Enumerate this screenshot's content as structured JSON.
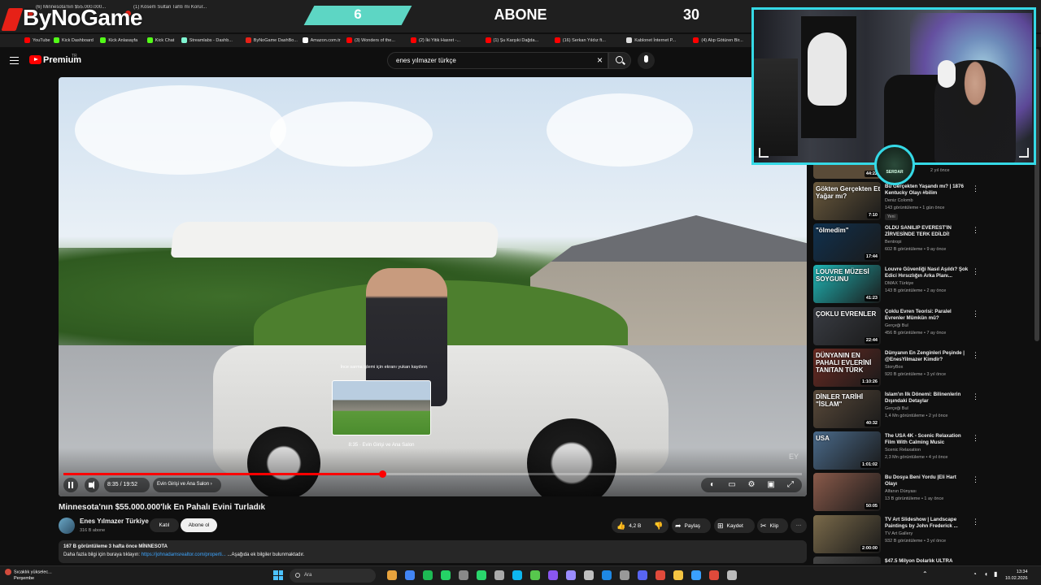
{
  "overlay": {
    "logo_text": "ByNoGame",
    "subscriber_count": "6",
    "label": "ABONE",
    "goal": "30"
  },
  "browser": {
    "tabs": [
      {
        "label": "(6) Minnesota'nın $55.000.000..."
      },
      {
        "label": "(1) Kösem Sultan Tahtı mı Korur..."
      },
      {
        "label": "ByNoGame"
      }
    ],
    "bookmarks": [
      {
        "label": "YouTube",
        "color": "#ff0000"
      },
      {
        "label": "Kick Dashboard",
        "color": "#53fc18"
      },
      {
        "label": "Kick Anlasayfa",
        "color": "#53fc18"
      },
      {
        "label": "Kick Chat",
        "color": "#53fc18"
      },
      {
        "label": "Streamlabs - Dashb...",
        "color": "#80f5d2"
      },
      {
        "label": "ByNoGame DashBo...",
        "color": "#e62117"
      },
      {
        "label": "Amazon.com.tr",
        "color": "#ffffff"
      },
      {
        "label": "(3) Wonders of the...",
        "color": "#ff0000"
      },
      {
        "label": "(2) İki Yitik Hasret -...",
        "color": "#ff0000"
      },
      {
        "label": "(1) Şu Karşıki Dağda...",
        "color": "#ff0000"
      },
      {
        "label": "(16) Serkan Yıldız ft...",
        "color": "#ff0000"
      },
      {
        "label": "Kablonet İnternet P...",
        "color": "#dddddd"
      },
      {
        "label": "(4) Alıp Götüren Bir...",
        "color": "#ff0000"
      }
    ]
  },
  "youtube": {
    "brand": "Premium",
    "country": "TR",
    "search_value": "enes yılmazer türkçe"
  },
  "player": {
    "seek_hint": "İnce sarma işlemi için ekranı yukarı kaydırın",
    "preview_label": "8:35 · Evin Girişi ve Ana Salon",
    "time": "8:35 / 19:52",
    "chapter": "Evin Girişi ve Ana Salon",
    "progress": 0.432,
    "watermark": "EY"
  },
  "video": {
    "title": "Minnesota'nın $55.000.000'lık En Pahalı Evini Turladık",
    "channel": "Enes Yılmazer Türkiye",
    "subscribers": "316 B abone",
    "join_label": "Katıl",
    "subscribed_label": "Abone ol",
    "likes": "4,2 B",
    "share_label": "Paylaş",
    "save_label": "Kaydet",
    "clip_label": "Klip",
    "views_line": "167 B görüntüleme  3 hafta önce  MİNNESOTA",
    "desc_prefix": "Daha fazla bilgi için buraya tıklayın: ",
    "desc_link": "https://johnadamsrealtor.com/properti...",
    "desc_suffix": "  ...Aşağıda ek bilgiler bulunmaktadır."
  },
  "sidebar": {
    "top_meta": "2 yıl önce",
    "top_duration": "44:22",
    "items": [
      {
        "title": "Bu Gerçekten Yaşandı mı? | 1876 Kentucky Olayı #bilim",
        "channel": "Deniz Colomb",
        "meta": "143 görüntüleme • 1 gün önce",
        "badge": "Yeni",
        "duration": "7:10",
        "thumb_text": "Gökten Gerçekten Et Yağar mı?",
        "color": "#6b5a3d"
      },
      {
        "title": "ÖLDÜ SANILIP EVEREST'İN ZİRVESİNDE TERK EDİLDİ!",
        "channel": "Bentropi",
        "meta": "602 B görüntüleme • 9 ay önce",
        "badge": "",
        "duration": "17:44",
        "thumb_text": "\"ölmedim\"",
        "color": "#10314f"
      },
      {
        "title": "Louvre Güvenliği Nasıl Aşıldı? Şok Edici Hırsızlığın Arka Planı...",
        "channel": "DMAX Türkiye",
        "meta": "143 B görüntüleme • 2 ay önce",
        "badge": "",
        "duration": "41:23",
        "thumb_text": "LOUVRE MÜZESİ SOYGUNU",
        "color": "#1fb5b5"
      },
      {
        "title": "Çoklu Evren Teorisi: Paralel Evrenler Mümkün mü?",
        "channel": "Gerçeği Bul",
        "meta": "456 B görüntüleme • 7 ay önce",
        "badge": "",
        "duration": "22:44",
        "thumb_text": "ÇOKLU EVRENLER",
        "color": "#3a3d44"
      },
      {
        "title": "Dünyanın En Zenginleri Peşinde | @EnesYilmazer  Kimdir?",
        "channel": "StoryBox",
        "meta": "920 B görüntüleme • 3 yıl önce",
        "badge": "",
        "duration": "1:10:26",
        "thumb_text": "DÜNYANIN EN PAHALI EVLERİNİ TANITAN TÜRK",
        "color": "#6b2a22"
      },
      {
        "title": "İslam'ın İlk Dönemi: Bilinenlerin Dışındaki Detaylar",
        "channel": "Gerçeği Bul",
        "meta": "1,4 Mn görüntüleme • 2 yıl önce",
        "badge": "",
        "duration": "40:32",
        "thumb_text": "DİNLER TARİHİ \"İSLAM\"",
        "color": "#5a4a3a"
      },
      {
        "title": "The USA 4K - Scenic Relaxation Film With Calming Music",
        "channel": "Scenic Relaxation",
        "meta": "2,3 Mn görüntüleme • 4 yıl önce",
        "badge": "",
        "duration": "1:01:02",
        "thumb_text": "USA",
        "color": "#4a6a8a"
      },
      {
        "title": "Bu Dosya Beni Yordu |Eli Hart Olayı",
        "channel": "Alfanın Dünyası",
        "meta": "13 B görüntüleme • 1 ay önce",
        "badge": "",
        "duration": "50:05",
        "thumb_text": "",
        "color": "#8a5a4a"
      },
      {
        "title": "TV Art Slideshow | Landscape Paintings by John Frederick ...",
        "channel": "TV Art Gallery",
        "meta": "932 B görüntüleme • 3 yıl önce",
        "badge": "",
        "duration": "2:00:00",
        "thumb_text": "",
        "color": "#7a6a4a"
      },
      {
        "title": "$47.5 Milyon Dolarlık ULTRA",
        "channel": "",
        "meta": "",
        "badge": "",
        "duration": "",
        "thumb_text": "",
        "color": "#444444"
      }
    ]
  },
  "cam": {
    "badge_text": "SERDAR"
  },
  "taskbar": {
    "weather_title": "Sıcaklık yükselec...",
    "weather_sub": "Perşembe",
    "search_placeholder": "Ara",
    "time": "13:34",
    "date": "10.02.2026"
  }
}
